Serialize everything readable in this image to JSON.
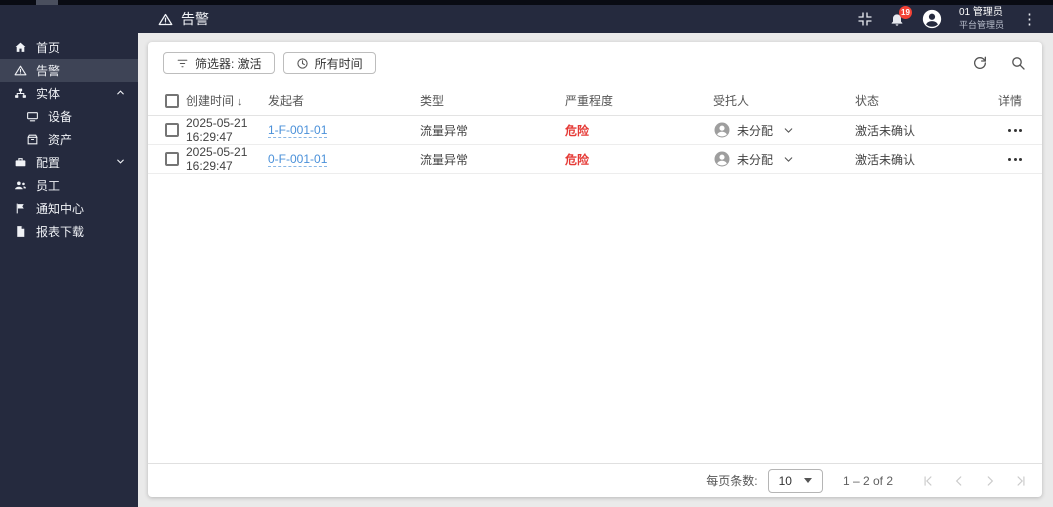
{
  "header": {
    "title": "告警",
    "notification_count": "19",
    "user_name": "01 管理员",
    "user_role": "平台管理员"
  },
  "sidebar": {
    "items": [
      {
        "label": "首页",
        "icon": "home-icon",
        "selected": false
      },
      {
        "label": "告警",
        "icon": "alert-icon",
        "selected": true
      },
      {
        "label": "实体",
        "icon": "entities-icon",
        "selected": false,
        "expanded": true
      },
      {
        "label": "设备",
        "icon": "device-icon",
        "selected": false,
        "child": true
      },
      {
        "label": "资产",
        "icon": "asset-icon",
        "selected": false,
        "child": true
      },
      {
        "label": "配置",
        "icon": "config-icon",
        "selected": false,
        "expanded": false
      },
      {
        "label": "员工",
        "icon": "staff-icon",
        "selected": false
      },
      {
        "label": "通知中心",
        "icon": "notification-icon",
        "selected": false
      },
      {
        "label": "报表下载",
        "icon": "report-icon",
        "selected": false
      }
    ]
  },
  "toolbar": {
    "filter_button": "筛选器: 激活",
    "time_button": "所有时间"
  },
  "table": {
    "columns": [
      "创建时间",
      "发起者",
      "类型",
      "严重程度",
      "受托人",
      "状态",
      "详情"
    ],
    "sort_column": "创建时间",
    "sort_direction": "desc",
    "rows": [
      {
        "created": "2025-05-21 16:29:47",
        "initiator": "1-F-001-01",
        "type": "流量异常",
        "severity": "危险",
        "assignee": "未分配",
        "status": "激活未确认"
      },
      {
        "created": "2025-05-21 16:29:47",
        "initiator": "0-F-001-01",
        "type": "流量异常",
        "severity": "危险",
        "assignee": "未分配",
        "status": "激活未确认"
      }
    ]
  },
  "pagination": {
    "per_page_label": "每页条数:",
    "per_page_value": "10",
    "range_text": "1 – 2 of 2"
  },
  "colors": {
    "sidebar_bg": "#252a3e",
    "selected_item_bg": "#3e4456",
    "link_blue": "#4a90d9",
    "severity_red": "#e53935",
    "badge_red": "#f44336"
  }
}
